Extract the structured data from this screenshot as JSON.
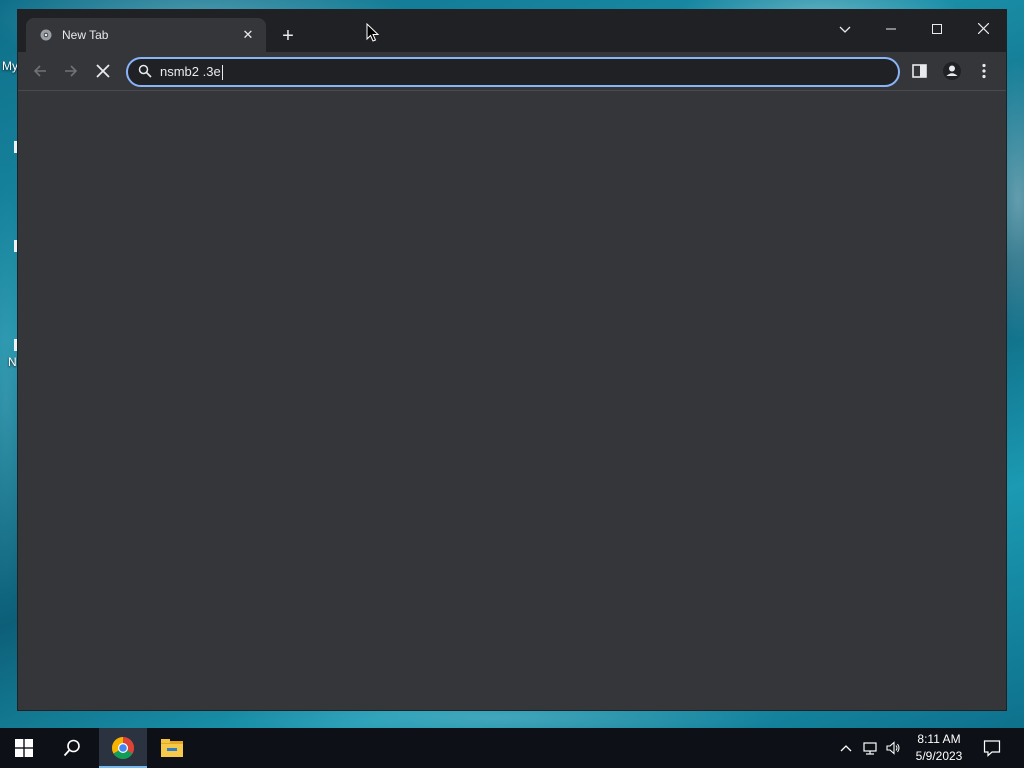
{
  "desktop": {
    "labels": [
      "My",
      "N"
    ]
  },
  "browser": {
    "tab": {
      "title": "New Tab",
      "favicon": "chrome-icon"
    },
    "new_tab_label": "+",
    "window_controls": {
      "tab_search": "chevron-down-icon",
      "minimize": "minimize-icon",
      "maximize": "maximize-icon",
      "close": "close-icon"
    },
    "omnibox": {
      "value": "nsmb2 .3e",
      "icon": "search-icon"
    },
    "nav": {
      "back": "arrow-left-icon",
      "forward": "arrow-right-icon",
      "stop": "stop-icon"
    },
    "toolbar_icons": [
      "side-panel-icon",
      "profile-icon",
      "menu-icon"
    ]
  },
  "taskbar": {
    "apps": [
      "windows-start-icon",
      "search-icon",
      "chrome-icon",
      "file-explorer-icon"
    ],
    "tray": [
      "chevron-up-icon",
      "network-icon",
      "volume-icon",
      "notification-icon"
    ],
    "clock": {
      "time": "8:11 AM",
      "date": "5/9/2023"
    }
  },
  "colors": {
    "accent": "#8ab4f8",
    "titlebar": "#202124",
    "surface": "#35363a",
    "taskbar": "#0d1117"
  }
}
